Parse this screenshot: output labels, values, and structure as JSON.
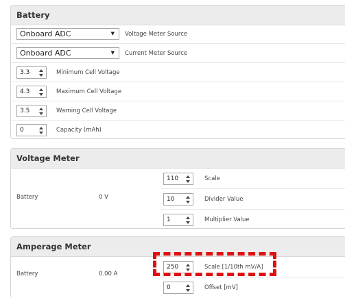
{
  "battery": {
    "title": "Battery",
    "voltage_source": {
      "value": "Onboard ADC",
      "label": "Voltage Meter Source"
    },
    "current_source": {
      "value": "Onboard ADC",
      "label": "Current Meter Source"
    },
    "fields": [
      {
        "value": "3.3",
        "label": "Minimum Cell Voltage"
      },
      {
        "value": "4.3",
        "label": "Maximum Cell Voltage"
      },
      {
        "value": "3.5",
        "label": "Warning Cell Voltage"
      },
      {
        "value": "0",
        "label": "Capacity (mAh)"
      }
    ]
  },
  "voltage_meter": {
    "title": "Voltage Meter",
    "name": "Battery",
    "reading": "0 V",
    "fields": [
      {
        "value": "110",
        "label": "Scale"
      },
      {
        "value": "10",
        "label": "Divider Value"
      },
      {
        "value": "1",
        "label": "Multiplier Value"
      }
    ]
  },
  "amperage_meter": {
    "title": "Amperage Meter",
    "name": "Battery",
    "reading": "0.00 A",
    "fields": [
      {
        "value": "250",
        "label": "Scale [1/10th mV/A]"
      },
      {
        "value": "0",
        "label": "Offset [mV]"
      }
    ]
  },
  "highlight_color": "#e01010",
  "icons": {
    "dropdown": "triangle-down-icon",
    "spinner": "up-down-spinner-icon"
  }
}
